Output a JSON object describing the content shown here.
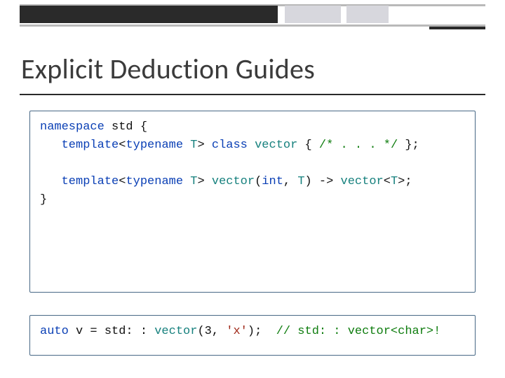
{
  "title": "Explicit Deduction Guides",
  "code_top": {
    "l1": {
      "kw1": "namespace",
      "id1": " std {"
    },
    "l2": {
      "pad": "   ",
      "kw1": "template",
      "p1": "<",
      "kw2": "typename",
      "p2": " ",
      "typ1": "T",
      "p3": "> ",
      "kw3": "class",
      "p4": " ",
      "typ2": "vector",
      "p5": " { ",
      "cm1": "/* . . . */",
      "p6": " };"
    },
    "l3": {
      "blank": " "
    },
    "l4": {
      "pad": "   ",
      "kw1": "template",
      "p1": "<",
      "kw2": "typename",
      "p2": " ",
      "typ1": "T",
      "p3": "> ",
      "typ2": "vector",
      "p4": "(",
      "kw3": "int",
      "p5": ", ",
      "typ3": "T",
      "p6": ") -> ",
      "typ4": "vector",
      "p7": "<",
      "typ5": "T",
      "p8": ">;"
    },
    "l5": {
      "close": "}"
    }
  },
  "code_bot": {
    "l1": {
      "kw1": "auto",
      "p1": " v = std: : ",
      "typ1": "vector",
      "p2": "(3, ",
      "str1": "'x'",
      "p3": ");  ",
      "cm1": "// std: : vector<char>!"
    }
  }
}
